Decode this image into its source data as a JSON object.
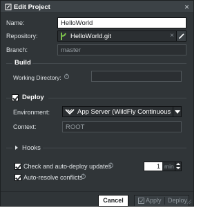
{
  "window": {
    "title": "Edit Project",
    "close_glyph": "×"
  },
  "form": {
    "name_label": "Name:",
    "name_value": "HelloWorld",
    "repository_label": "Repository:",
    "repository_value": "HelloWorld.git",
    "repository_clear_glyph": "×",
    "branch_label": "Branch:",
    "branch_value": "master"
  },
  "build": {
    "title": "Build",
    "working_dir_label": "Working Directory:",
    "working_dir_value": ""
  },
  "deploy": {
    "title": "Deploy",
    "checked": true,
    "environment_label": "Environment:",
    "environment_value": "App Server (WildFly Continuous",
    "context_label": "Context:",
    "context_value": "ROOT"
  },
  "hooks": {
    "title": "Hooks"
  },
  "options": {
    "auto_update_label": "Check and auto-deploy updates",
    "auto_update_checked": true,
    "interval_value": "1",
    "interval_unit": "min",
    "auto_resolve_label": "Auto-resolve conflicts",
    "auto_resolve_checked": true
  },
  "footer": {
    "cancel_label": "Cancel",
    "apply_label": "Apply",
    "deploy_label": "Deploy"
  },
  "icons": {
    "help": "?",
    "colors": {
      "git_green": "#7cc04b",
      "accent_bg": "#303538"
    }
  }
}
